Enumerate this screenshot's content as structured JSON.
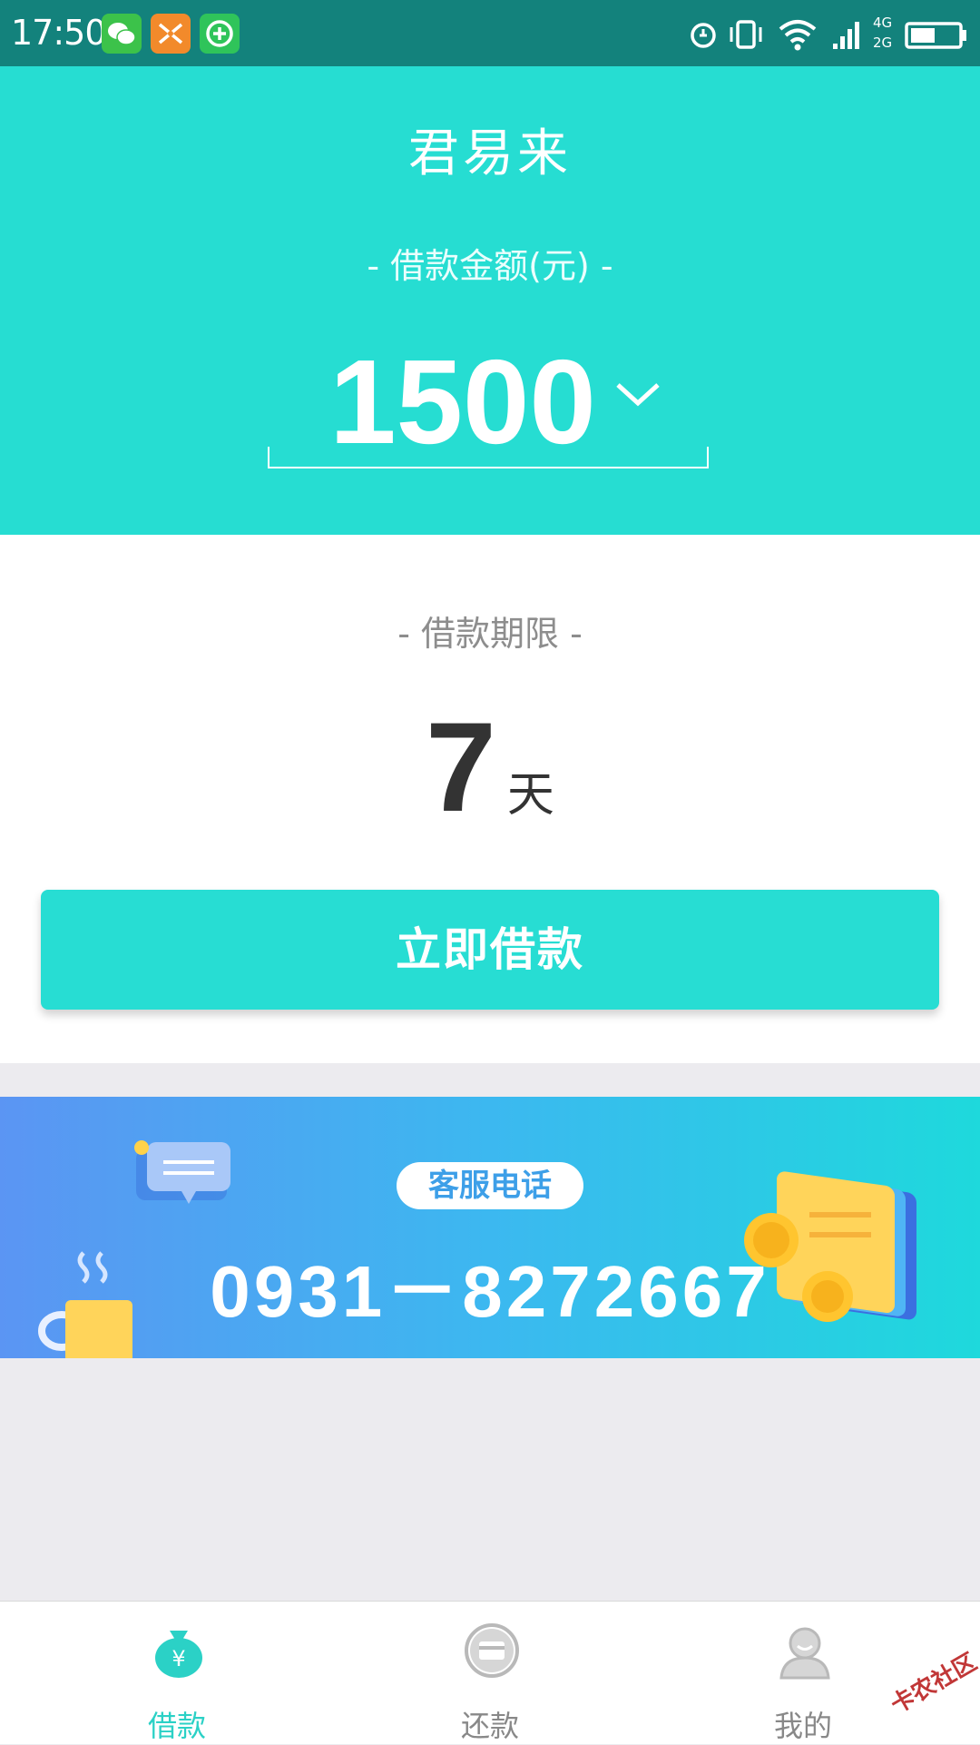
{
  "status_bar": {
    "time": "17:50",
    "network_labels": [
      "4G",
      "2G"
    ],
    "app_icons": [
      "wechat-icon",
      "shuffle-app-icon",
      "plus-app-icon"
    ],
    "system_icons": [
      "alarm-icon",
      "vibrate-icon",
      "wifi-icon",
      "signal-icon",
      "battery-icon"
    ],
    "bar_color": "#13827c"
  },
  "header": {
    "title": "君易来",
    "amount_label": "- 借款金额(元) -",
    "amount_value": "1500",
    "dropdown_icon": "chevron-down-icon",
    "bg_color": "#26ddd2"
  },
  "term": {
    "label": "- 借款期限 -",
    "value": "7",
    "unit": "天"
  },
  "actions": {
    "borrow_button_label": "立即借款",
    "accent_color": "#27ddd3"
  },
  "banner": {
    "pill_label": "客服电话",
    "phone_number": "0931－8272667"
  },
  "bottom_nav": {
    "items": [
      {
        "label": "借款",
        "icon": "money-bag-icon",
        "active": true
      },
      {
        "label": "还款",
        "icon": "repay-card-icon",
        "active": false
      },
      {
        "label": "我的",
        "icon": "user-profile-icon",
        "active": false
      }
    ]
  },
  "watermark": "卡农社区"
}
